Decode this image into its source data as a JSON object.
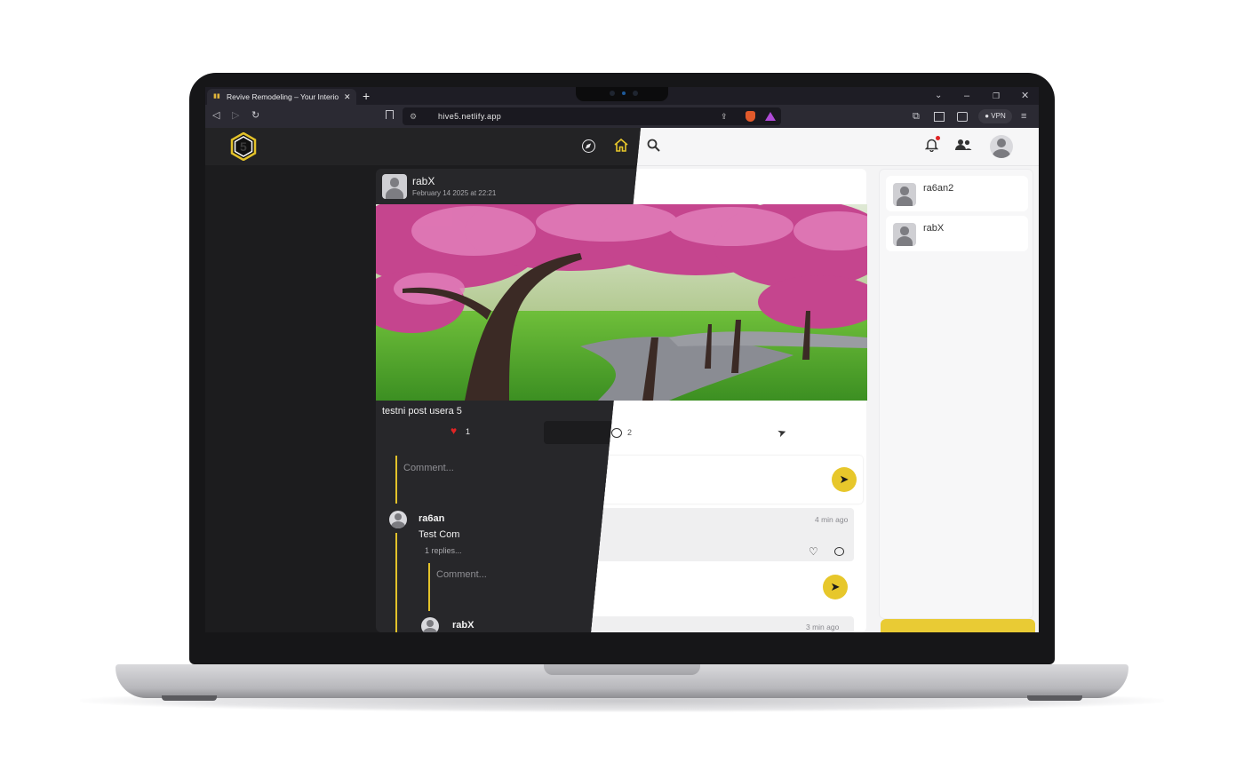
{
  "browser": {
    "tab_title": "Revive Remodeling – Your Interio",
    "tab_close": "✕",
    "new_tab": "+",
    "url": "hive5.netlify.app",
    "vpn_label": "VPN",
    "window_controls": [
      "⌄",
      "–",
      "❐",
      "✕"
    ]
  },
  "app": {
    "logo_text": "5",
    "nav_icons": [
      "compass-icon",
      "home-icon",
      "search-icon"
    ],
    "header_icons": [
      "bell-icon",
      "users-icon",
      "profile-avatar"
    ],
    "accent_color": "#e7c72b",
    "notification_dot_color": "#e02424"
  },
  "post": {
    "author": "rabX",
    "date": "February 14 2025 at 22:21",
    "caption": "testni post usera 5",
    "likes": "1",
    "comments": "2",
    "comment_placeholder": "Comment..."
  },
  "comments": [
    {
      "author": "ra6an",
      "time": "4 min ago",
      "text": "Test Com",
      "replies_label": "1 replies...",
      "reply_placeholder": "Comment...",
      "replies": [
        {
          "author": "rabX",
          "time": "3 min ago"
        }
      ]
    }
  ],
  "friends": [
    {
      "name": "ra6an2"
    },
    {
      "name": "rabX"
    }
  ]
}
